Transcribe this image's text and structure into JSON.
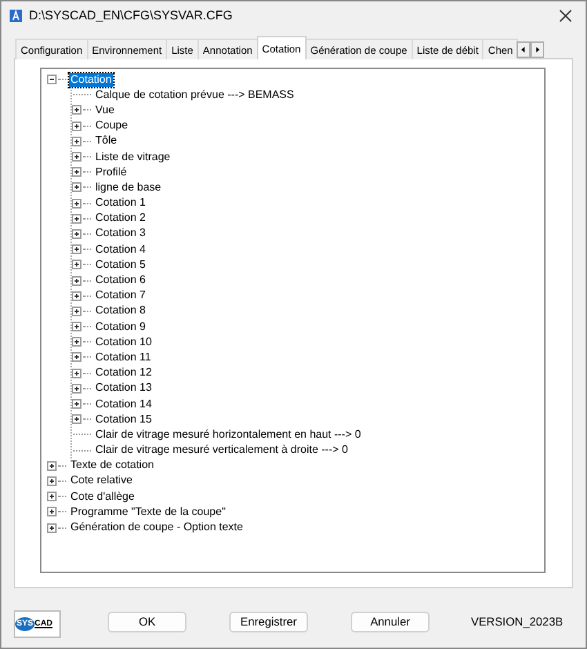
{
  "window": {
    "title": "D:\\SYSCAD_EN\\CFG\\SYSVAR.CFG"
  },
  "tabs": [
    {
      "label": "Configuration",
      "selected": false
    },
    {
      "label": "Environnement",
      "selected": false
    },
    {
      "label": "Liste",
      "selected": false
    },
    {
      "label": "Annotation",
      "selected": false
    },
    {
      "label": "Cotation",
      "selected": true
    },
    {
      "label": "Génération de coupe",
      "selected": false
    },
    {
      "label": "Liste de débit",
      "selected": false
    },
    {
      "label": "Chen",
      "selected": false
    }
  ],
  "tree": [
    {
      "label": "Cotation",
      "selected": true,
      "expanded": true,
      "children": [
        {
          "label": "Calque de cotation prévue  --->  BEMASS",
          "selected": false
        },
        {
          "label": "Vue",
          "selected": false,
          "expanded": false
        },
        {
          "label": "Coupe",
          "selected": false,
          "expanded": false
        },
        {
          "label": "Tôle",
          "selected": false,
          "expanded": false
        },
        {
          "label": "Liste de vitrage",
          "selected": false,
          "expanded": false
        },
        {
          "label": "Profilé",
          "selected": false,
          "expanded": false
        },
        {
          "label": "ligne de base",
          "selected": false,
          "expanded": false
        },
        {
          "label": "Cotation 1",
          "selected": false,
          "expanded": false
        },
        {
          "label": "Cotation 2",
          "selected": false,
          "expanded": false
        },
        {
          "label": "Cotation 3",
          "selected": false,
          "expanded": false
        },
        {
          "label": "Cotation 4",
          "selected": false,
          "expanded": false
        },
        {
          "label": "Cotation 5",
          "selected": false,
          "expanded": false
        },
        {
          "label": "Cotation 6",
          "selected": false,
          "expanded": false
        },
        {
          "label": "Cotation 7",
          "selected": false,
          "expanded": false
        },
        {
          "label": "Cotation 8",
          "selected": false,
          "expanded": false
        },
        {
          "label": "Cotation 9",
          "selected": false,
          "expanded": false
        },
        {
          "label": "Cotation 10",
          "selected": false,
          "expanded": false
        },
        {
          "label": "Cotation 11",
          "selected": false,
          "expanded": false
        },
        {
          "label": "Cotation 12",
          "selected": false,
          "expanded": false
        },
        {
          "label": "Cotation 13",
          "selected": false,
          "expanded": false
        },
        {
          "label": "Cotation 14",
          "selected": false,
          "expanded": false
        },
        {
          "label": "Cotation 15",
          "selected": false,
          "expanded": false
        },
        {
          "label": "Clair de vitrage mesuré horizontalement en haut  --->  0",
          "selected": false
        },
        {
          "label": "Clair de vitrage mesuré verticalement à droite  --->  0",
          "selected": false
        }
      ]
    },
    {
      "label": "Texte de cotation",
      "selected": false,
      "expanded": false
    },
    {
      "label": "Cote relative",
      "selected": false,
      "expanded": false
    },
    {
      "label": "Cote d'allège",
      "selected": false,
      "expanded": false
    },
    {
      "label": "Programme \"Texte de la coupe\"",
      "selected": false,
      "expanded": false
    },
    {
      "label": "Génération de coupe - Option texte",
      "selected": false,
      "expanded": false
    }
  ],
  "logo": {
    "parts": [
      "SYS",
      "CAD"
    ]
  },
  "buttons": [
    "OK",
    "Enregistrer",
    "Annuler"
  ],
  "version": "VERSION_2023B"
}
